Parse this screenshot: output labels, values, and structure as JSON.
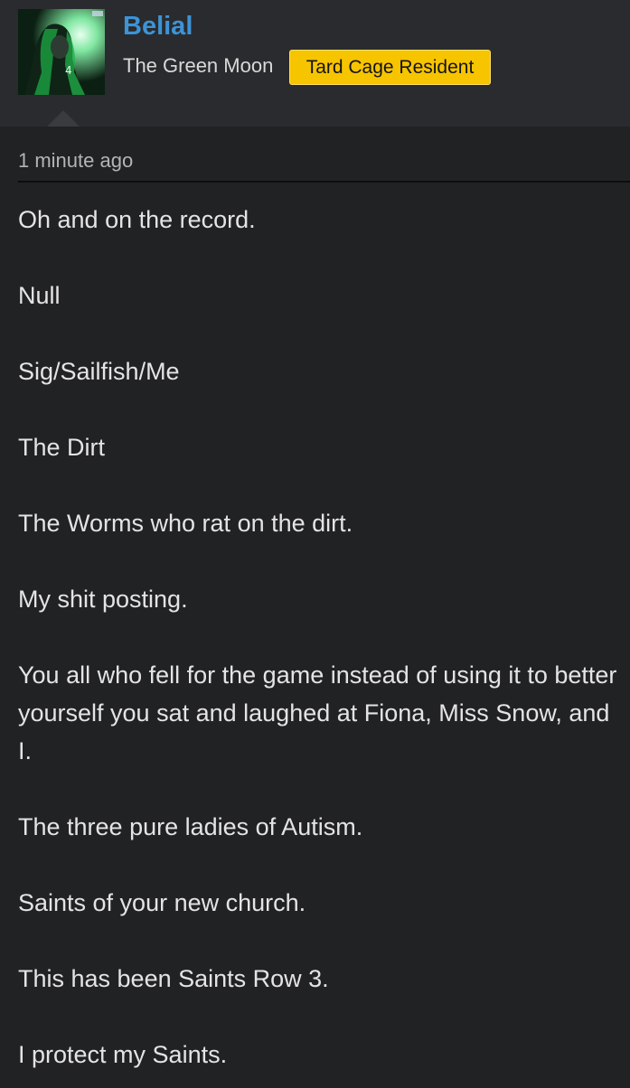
{
  "post": {
    "author": {
      "name": "Belial",
      "title": "The Green Moon",
      "banner": "Tard Cage Resident"
    },
    "timestamp": "1 minute ago",
    "lines": [
      "Oh and on the record.",
      "Null",
      "Sig/Sailfish/Me",
      "The Dirt",
      "The Worms who rat on the dirt.",
      "My shit posting.",
      "You all who fell for the game instead of using it to better yourself you sat and laughed at Fiona, Miss Snow, and I.",
      "The three pure ladies of Autism.",
      "Saints of your new church.",
      "This has been Saints Row 3.",
      "I protect my Saints."
    ]
  },
  "colors": {
    "username": "#3d93d6",
    "banner_bg": "#f7c400",
    "page_bg": "#212224",
    "header_bg": "#2a2b2e"
  }
}
